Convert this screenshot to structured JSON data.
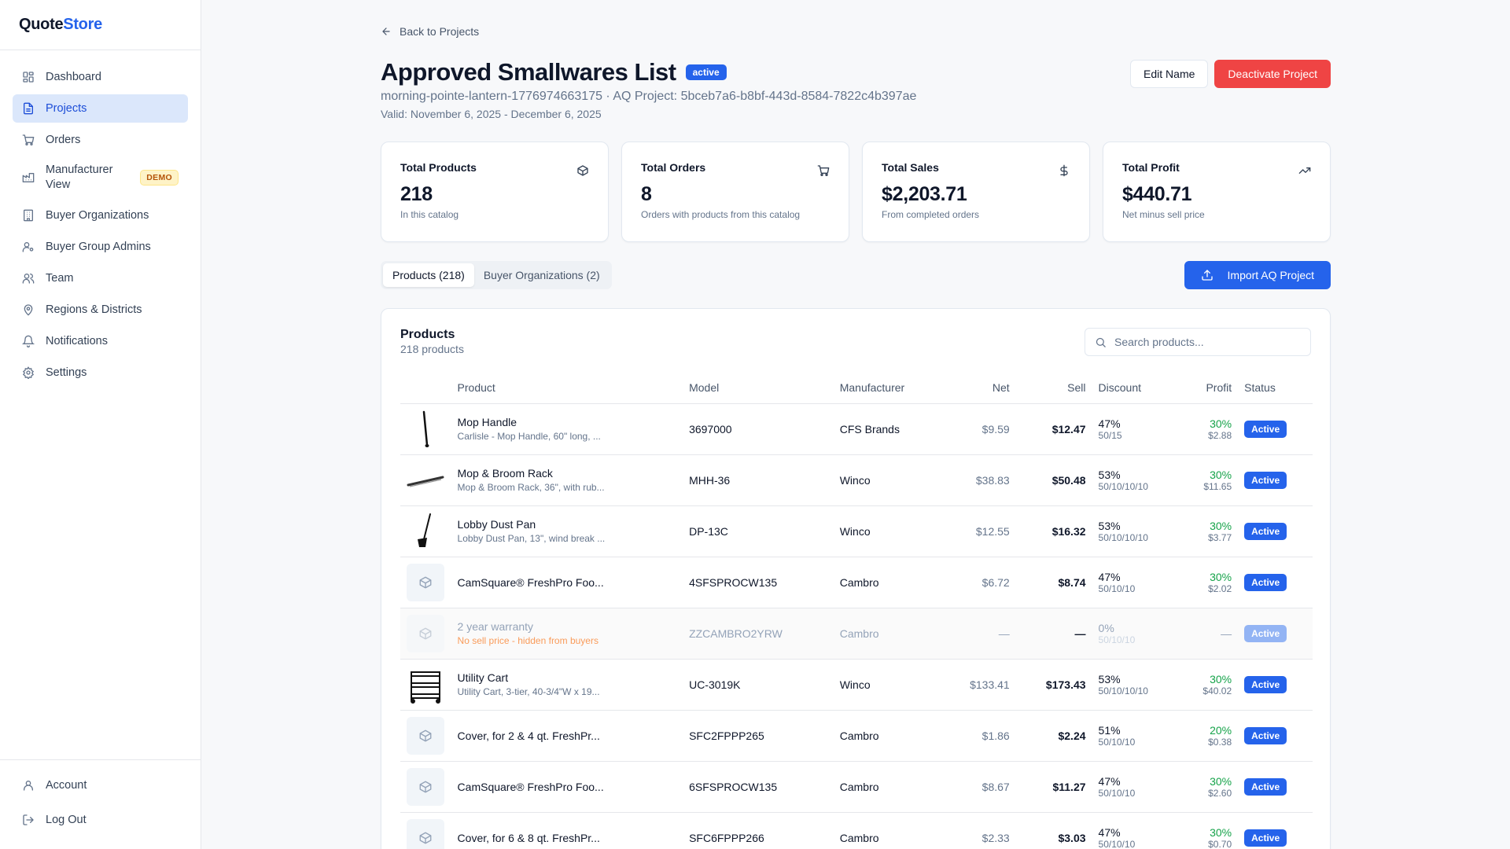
{
  "brand": {
    "part1": "Quote",
    "part2": "Store"
  },
  "sidebar": {
    "items": [
      {
        "label": "Dashboard",
        "icon": "dashboard-icon"
      },
      {
        "label": "Projects",
        "icon": "document-icon",
        "active": true
      },
      {
        "label": "Orders",
        "icon": "cart-icon"
      },
      {
        "label": "Manufacturer View",
        "icon": "factory-icon",
        "badge": "DEMO"
      },
      {
        "label": "Buyer Organizations",
        "icon": "building-icon"
      },
      {
        "label": "Buyer Group Admins",
        "icon": "user-cog-icon"
      },
      {
        "label": "Team",
        "icon": "users-icon"
      },
      {
        "label": "Regions & Districts",
        "icon": "map-pin-icon"
      },
      {
        "label": "Notifications",
        "icon": "bell-icon"
      },
      {
        "label": "Settings",
        "icon": "gear-icon"
      }
    ],
    "bottom": [
      {
        "label": "Account",
        "icon": "user-icon"
      },
      {
        "label": "Log Out",
        "icon": "logout-icon"
      }
    ]
  },
  "header": {
    "back_label": "Back to Projects",
    "title": "Approved Smallwares List",
    "status": "active",
    "subtitle": "morning-pointe-lantern-1776974663175 · AQ Project: 5bceb7a6-b8bf-443d-8584-7822c4b397ae",
    "validity": "Valid: November 6, 2025 - December 6, 2025",
    "edit_label": "Edit Name",
    "deactivate_label": "Deactivate Project"
  },
  "stats": [
    {
      "label": "Total Products",
      "value": "218",
      "note": "In this catalog",
      "icon": "box-icon"
    },
    {
      "label": "Total Orders",
      "value": "8",
      "note": "Orders with products from this catalog",
      "icon": "cart-icon"
    },
    {
      "label": "Total Sales",
      "value": "$2,203.71",
      "note": "From completed orders",
      "icon": "dollar-icon"
    },
    {
      "label": "Total Profit",
      "value": "$440.71",
      "note": "Net minus sell price",
      "icon": "trending-up-icon"
    }
  ],
  "tabs": [
    {
      "label": "Products (218)",
      "active": true
    },
    {
      "label": "Buyer Organizations (2)",
      "active": false
    }
  ],
  "import_label": "Import AQ Project",
  "products": {
    "title": "Products",
    "count": "218 products",
    "search_placeholder": "Search products...",
    "columns": [
      "Product",
      "Model",
      "Manufacturer",
      "Net",
      "Sell",
      "Discount",
      "Profit",
      "Status"
    ],
    "rows": [
      {
        "thumb": "mop",
        "name": "Mop Handle",
        "desc": "Carlisle - Mop Handle, 60\" long, ...",
        "model": "3697000",
        "mfr": "CFS Brands",
        "net": "$9.59",
        "sell": "$12.47",
        "disc": "47%",
        "disc_sub": "50/15",
        "profit_pct": "30%",
        "profit_amt": "$2.88",
        "status": "Active"
      },
      {
        "thumb": "rack",
        "name": "Mop & Broom Rack",
        "desc": "Mop & Broom Rack, 36\", with rub...",
        "model": "MHH-36",
        "mfr": "Winco",
        "net": "$38.83",
        "sell": "$50.48",
        "disc": "53%",
        "disc_sub": "50/10/10/10",
        "profit_pct": "30%",
        "profit_amt": "$11.65",
        "status": "Active"
      },
      {
        "thumb": "dustpan",
        "name": "Lobby Dust Pan",
        "desc": "Lobby Dust Pan, 13\", wind break ...",
        "model": "DP-13C",
        "mfr": "Winco",
        "net": "$12.55",
        "sell": "$16.32",
        "disc": "53%",
        "disc_sub": "50/10/10/10",
        "profit_pct": "30%",
        "profit_amt": "$3.77",
        "status": "Active"
      },
      {
        "thumb": "placeholder",
        "name": "CamSquare® FreshPro Foo...",
        "desc": "",
        "model": "4SFSPROCW135",
        "mfr": "Cambro",
        "net": "$6.72",
        "sell": "$8.74",
        "disc": "47%",
        "disc_sub": "50/10/10",
        "profit_pct": "30%",
        "profit_amt": "$2.02",
        "status": "Active"
      },
      {
        "thumb": "placeholder",
        "name": "2 year warranty",
        "desc": "No sell price - hidden from buyers",
        "model": "ZZCAMBRO2YRW",
        "mfr": "Cambro",
        "net": "—",
        "sell": "—",
        "disc": "0%",
        "disc_sub": "50/10/10",
        "profit_pct": "",
        "profit_amt": "—",
        "status": "Active",
        "muted": true
      },
      {
        "thumb": "cart",
        "name": "Utility Cart",
        "desc": "Utility Cart, 3-tier, 40-3/4\"W x 19...",
        "model": "UC-3019K",
        "mfr": "Winco",
        "net": "$133.41",
        "sell": "$173.43",
        "disc": "53%",
        "disc_sub": "50/10/10/10",
        "profit_pct": "30%",
        "profit_amt": "$40.02",
        "status": "Active"
      },
      {
        "thumb": "placeholder",
        "name": "Cover, for 2 & 4 qt. FreshPr...",
        "desc": "",
        "model": "SFC2FPPP265",
        "mfr": "Cambro",
        "net": "$1.86",
        "sell": "$2.24",
        "disc": "51%",
        "disc_sub": "50/10/10",
        "profit_pct": "20%",
        "profit_amt": "$0.38",
        "status": "Active"
      },
      {
        "thumb": "placeholder",
        "name": "CamSquare® FreshPro Foo...",
        "desc": "",
        "model": "6SFSPROCW135",
        "mfr": "Cambro",
        "net": "$8.67",
        "sell": "$11.27",
        "disc": "47%",
        "disc_sub": "50/10/10",
        "profit_pct": "30%",
        "profit_amt": "$2.60",
        "status": "Active"
      },
      {
        "thumb": "placeholder",
        "name": "Cover, for 6 & 8 qt. FreshPr...",
        "desc": "",
        "model": "SFC6FPPP266",
        "mfr": "Cambro",
        "net": "$2.33",
        "sell": "$3.03",
        "disc": "47%",
        "disc_sub": "50/10/10",
        "profit_pct": "30%",
        "profit_amt": "$0.70",
        "status": "Active"
      }
    ]
  }
}
